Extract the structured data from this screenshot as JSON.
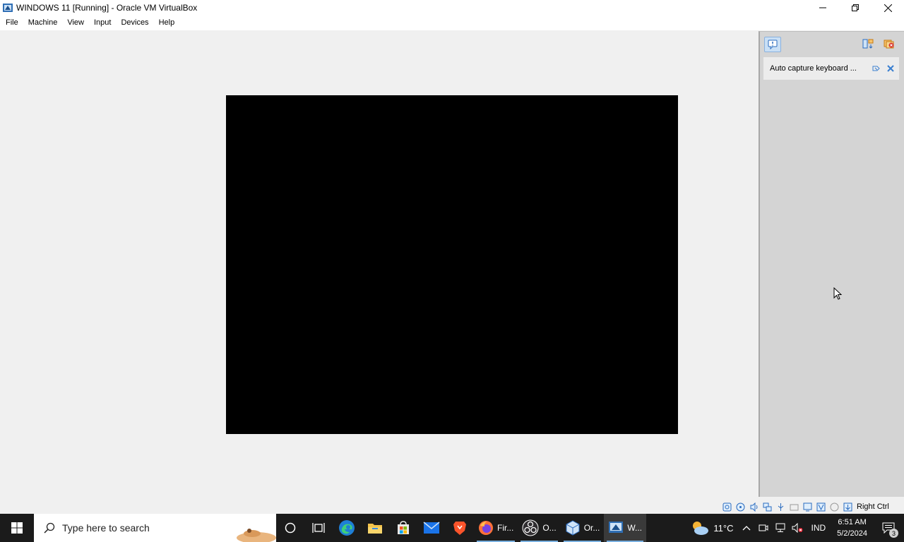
{
  "window": {
    "title": "WINDOWS 11 [Running] - Oracle VM VirtualBox",
    "app_icon": "virtualbox-icon",
    "controls": [
      "minimize-icon",
      "restore-icon",
      "close-icon"
    ]
  },
  "menu": {
    "items": [
      "File",
      "Machine",
      "View",
      "Input",
      "Devices",
      "Help"
    ]
  },
  "vm_display": {
    "color": "#000000"
  },
  "notification_panel": {
    "toggle_icon": "notification-center-icon",
    "buttons": [
      "toggle-messages-icon",
      "delete-all-icon"
    ],
    "items": [
      {
        "text": "Auto capture keyboard ...",
        "icons": [
          "keep-icon",
          "remove-icon"
        ]
      }
    ]
  },
  "statusbar": {
    "icons": [
      "hard-disk-icon",
      "optical-drive-icon",
      "audio-icon",
      "network-icon",
      "usb-icon",
      "shared-folders-icon",
      "display-icon",
      "recording-icon",
      "cpu-icon",
      "mouse-integration-icon",
      "keyboard-icon"
    ],
    "host_key": "Right Ctrl"
  },
  "taskbar": {
    "search_placeholder": "Type here to search",
    "pinned": [
      "cortana-icon",
      "task-view-icon",
      "edge-icon",
      "file-explorer-icon",
      "microsoft-store-icon",
      "mail-icon",
      "brave-icon"
    ],
    "apps": [
      {
        "label": "Fir...",
        "icon": "firefox-icon"
      },
      {
        "label": "O...",
        "icon": "obs-icon"
      },
      {
        "label": "Or...",
        "icon": "virtualbox-icon"
      },
      {
        "label": "W...",
        "icon": "virtualbox-vm-icon"
      }
    ],
    "weather": {
      "temp": "11°C",
      "icon": "weather-cloudy-icon"
    },
    "tray": {
      "icons": [
        "chevron-up-icon",
        "meet-now-icon",
        "network-icon",
        "volume-muted-icon"
      ],
      "language": "IND",
      "time": "6:51 AM",
      "date": "5/2/2024",
      "notification_count": "3"
    }
  }
}
